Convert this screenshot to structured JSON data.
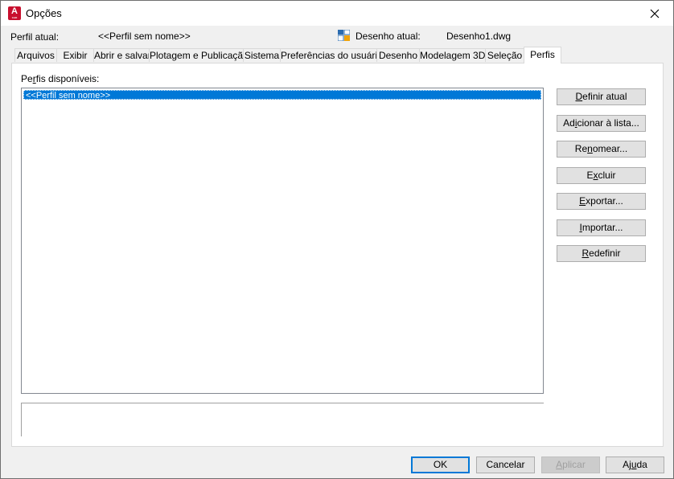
{
  "window": {
    "title": "Opções",
    "app_icon_letter": "A",
    "app_icon_sub": "CAD"
  },
  "header": {
    "profile_label": "Perfil atual:",
    "profile_value": "<<Perfil sem nome>>",
    "drawing_label": "Desenho atual:",
    "drawing_value": "Desenho1.dwg"
  },
  "tabs": [
    {
      "label": "Arquivos"
    },
    {
      "label": "Exibir"
    },
    {
      "label": "Abrir e salvar"
    },
    {
      "label": "Plotagem e Publicação"
    },
    {
      "label": "Sistema"
    },
    {
      "label": "Preferências do usuário"
    },
    {
      "label": "Desenho"
    },
    {
      "label": "Modelagem 3D"
    },
    {
      "label": "Seleção"
    },
    {
      "label": "Perfis",
      "active": true
    }
  ],
  "profiles": {
    "available_label_pre": "Pe",
    "available_label_ul": "r",
    "available_label_post": "fis disponíveis:",
    "items": [
      "<<Perfil sem nome>>"
    ],
    "selected": "<<Perfil sem nome>>"
  },
  "side_buttons": [
    {
      "pre": "",
      "ul": "D",
      "post": "efinir atual"
    },
    {
      "pre": "Ad",
      "ul": "i",
      "post": "cionar à lista..."
    },
    {
      "pre": "Re",
      "ul": "n",
      "post": "omear..."
    },
    {
      "pre": "E",
      "ul": "x",
      "post": "cluir"
    },
    {
      "pre": "",
      "ul": "E",
      "post": "xportar..."
    },
    {
      "pre": "",
      "ul": "I",
      "post": "mportar..."
    },
    {
      "pre": "",
      "ul": "R",
      "post": "edefinir"
    }
  ],
  "footer": {
    "ok": "OK",
    "cancel": "Cancelar",
    "apply_pre": "",
    "apply_ul": "A",
    "apply_post": "plicar",
    "help_pre": "Aj",
    "help_ul": "u",
    "help_post": "da"
  },
  "colors": {
    "selection": "#0078d7",
    "app_icon": "#c8102e"
  }
}
